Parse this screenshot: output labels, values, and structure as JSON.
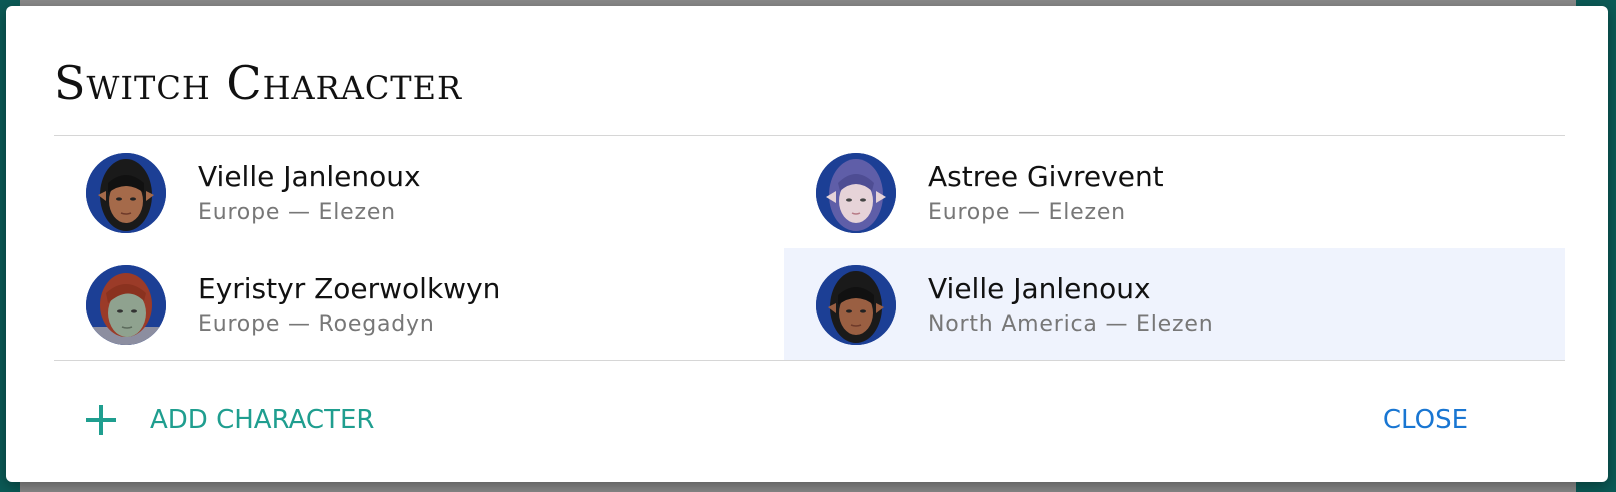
{
  "dialog": {
    "title": "Switch Character",
    "characters": [
      {
        "name": "Vielle Janlenoux",
        "subtitle": "Europe — Elezen",
        "avatar": "elezen-portrait-dark-hair",
        "selected": false
      },
      {
        "name": "Astree Givrevent",
        "subtitle": "Europe — Elezen",
        "avatar": "elezen-portrait-purple-hair",
        "selected": false
      },
      {
        "name": "Eyristyr Zoerwolkwyn",
        "subtitle": "Europe — Roegadyn",
        "avatar": "roegadyn-portrait-red-hair",
        "selected": false
      },
      {
        "name": "Vielle Janlenoux",
        "subtitle": "North America — Elezen",
        "avatar": "elezen-portrait-dark-hair",
        "selected": true
      }
    ],
    "add_label": "ADD CHARACTER",
    "close_label": "CLOSE"
  },
  "colors": {
    "accent_add": "#1f9e8f",
    "accent_close": "#1976d2",
    "selected_row": "#eff3fd",
    "avatar_bg": "#1c3f95"
  }
}
